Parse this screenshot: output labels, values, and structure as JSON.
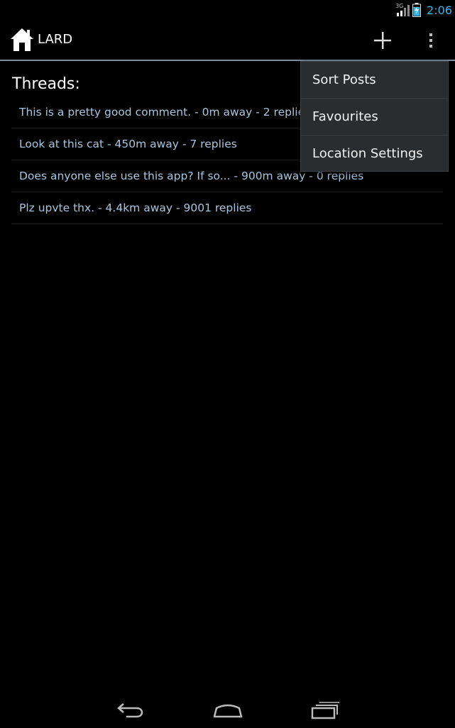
{
  "status_bar": {
    "network": "3G",
    "time": "2:06"
  },
  "action_bar": {
    "title": "LARD",
    "icons": {
      "home": "home-icon",
      "add": "plus-icon",
      "overflow": "overflow-menu-icon"
    }
  },
  "content": {
    "heading": "Threads:",
    "threads": [
      "This is a pretty good comment. - 0m away - 2 replies",
      "Look at this cat - 450m away - 7 replies",
      "Does anyone else use this app? If so... - 900m away - 0 replies",
      "Plz upvte thx. - 4.4km away - 9001 replies"
    ]
  },
  "overflow_menu": {
    "items": [
      "Sort Posts",
      "Favourites",
      "Location Settings"
    ]
  },
  "colors": {
    "accent": "#33b5e5",
    "thread_text": "#a9c4dc",
    "menu_bg": "#2a2d30"
  }
}
